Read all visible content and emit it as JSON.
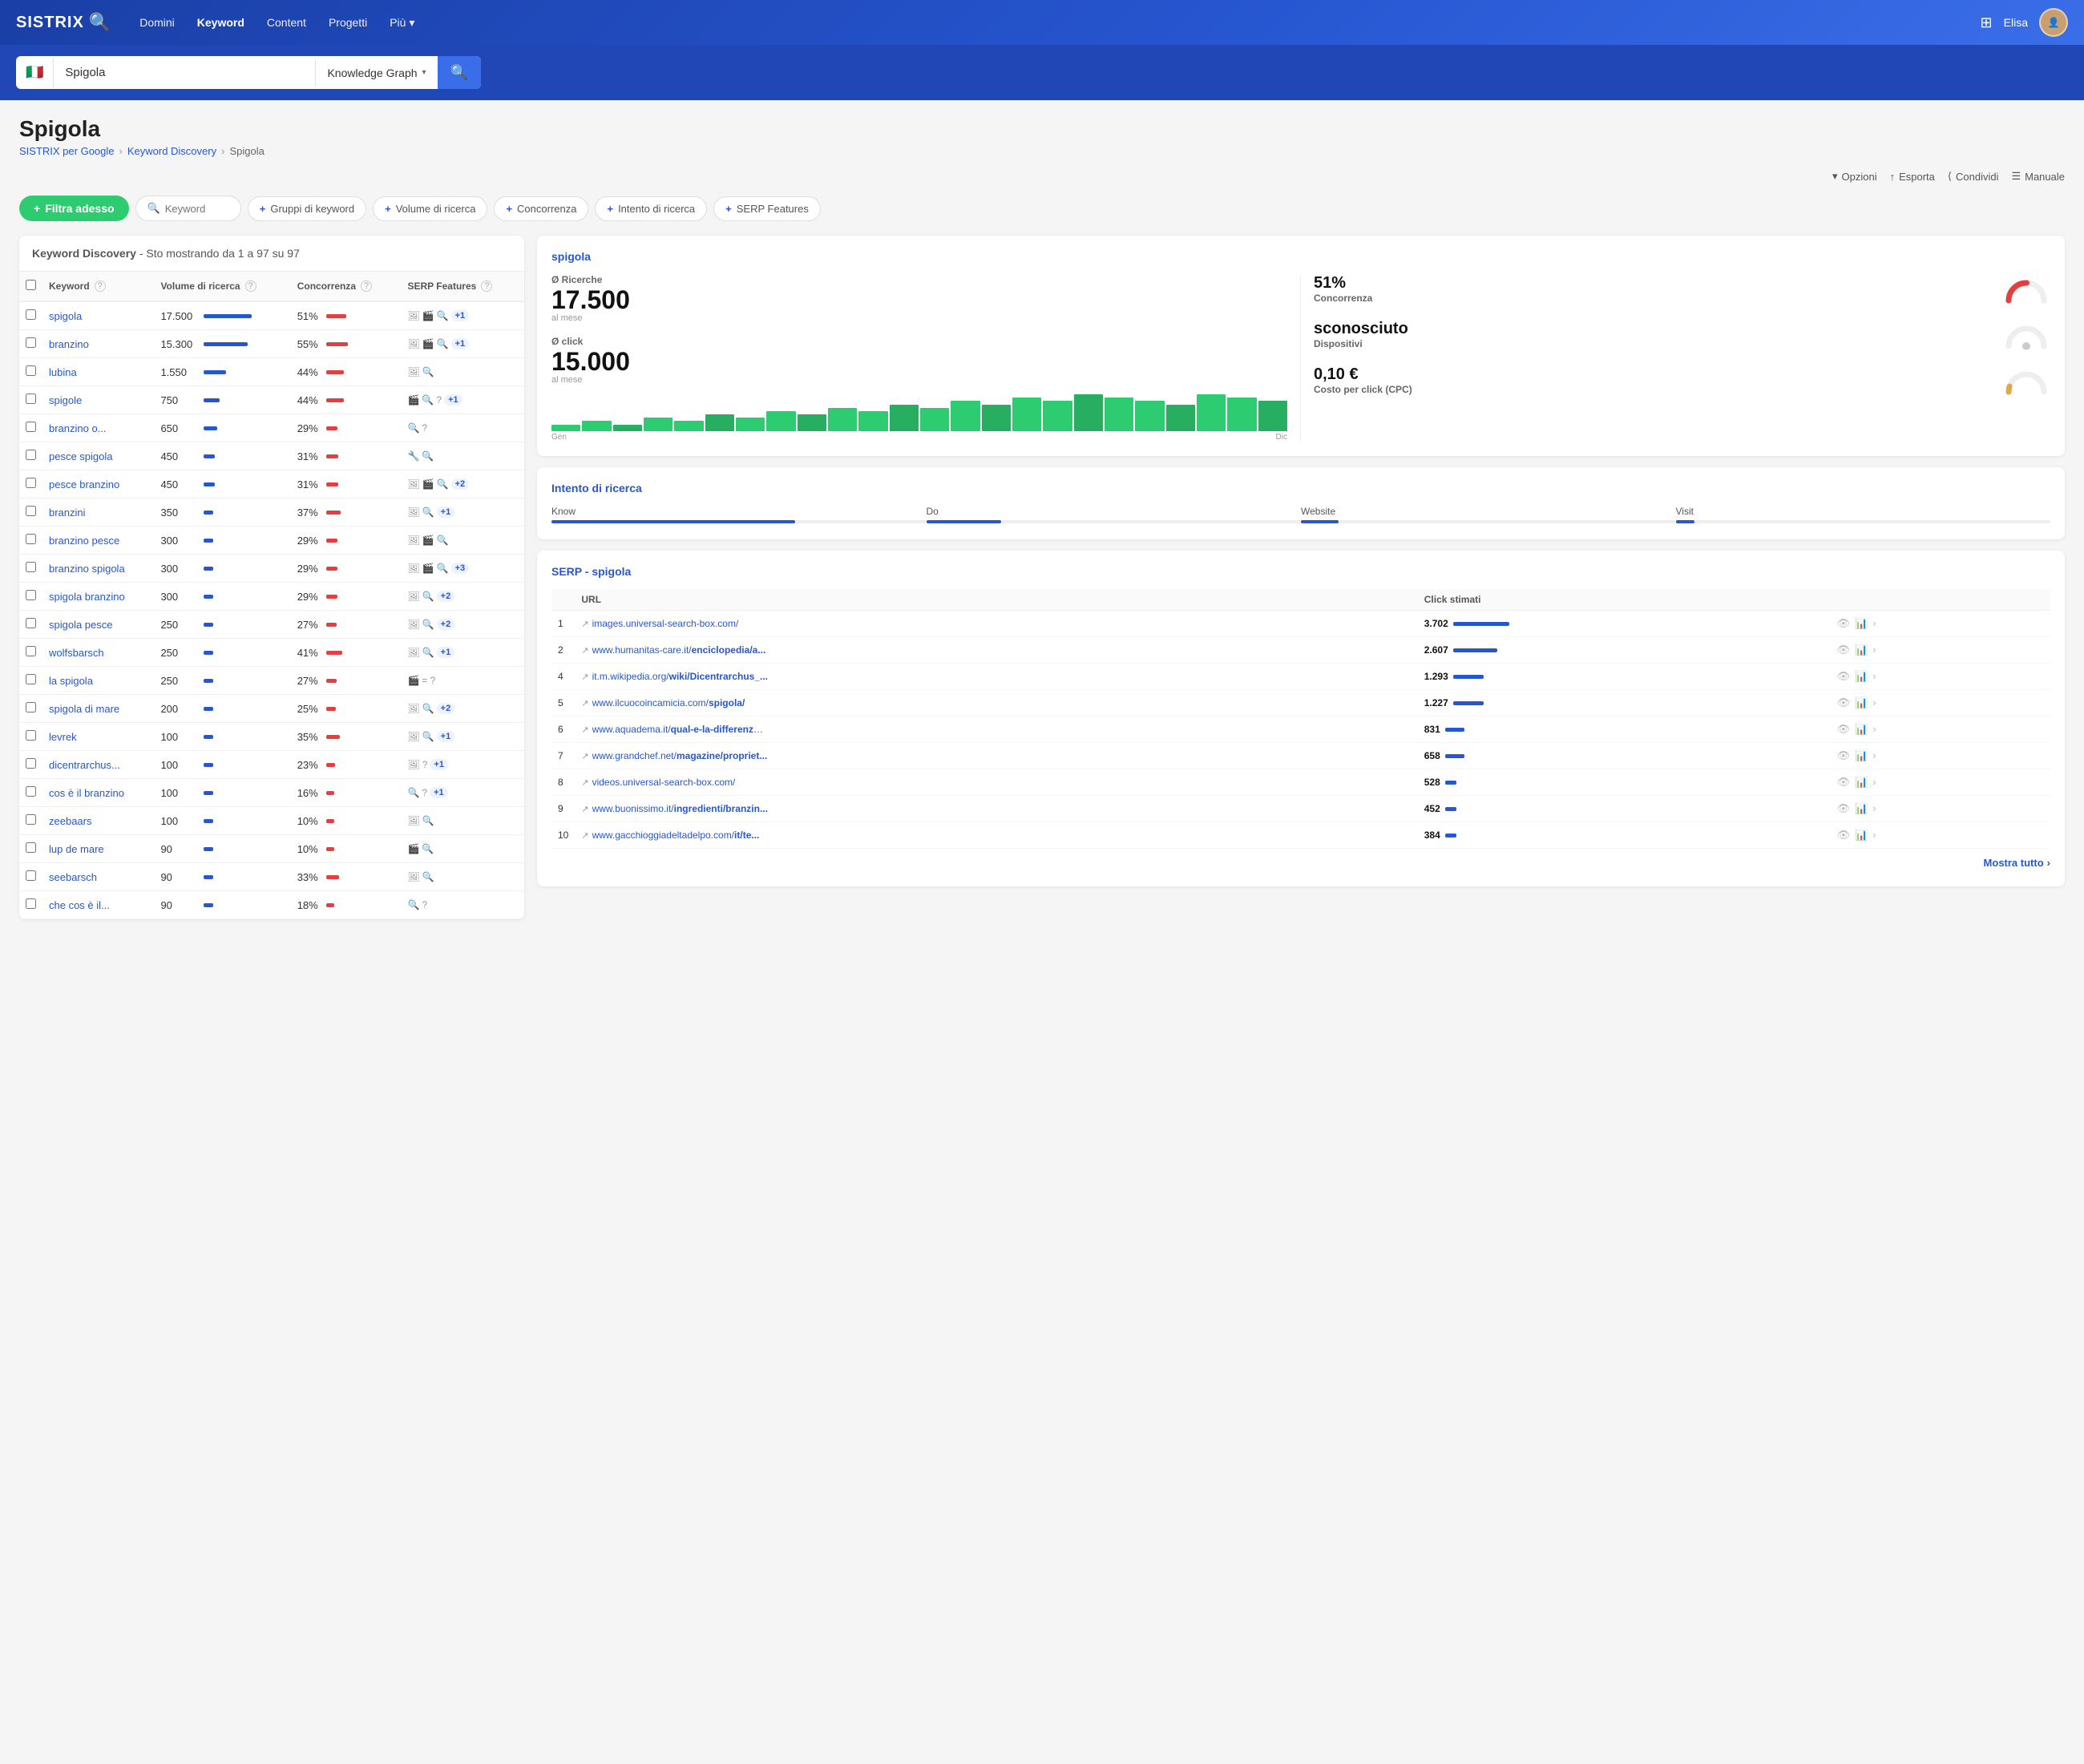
{
  "nav": {
    "logo": "SISTRIX",
    "links": [
      "Domini",
      "Keyword",
      "Content",
      "Progetti",
      "Più"
    ],
    "user": "Elisa"
  },
  "search": {
    "flag": "🇮🇹",
    "query": "Spigola",
    "mode": "Knowledge Graph",
    "placeholder": "Keyword"
  },
  "page": {
    "title": "Spigola",
    "breadcrumb": [
      "SISTRIX per Google",
      "Keyword Discovery",
      "Spigola"
    ],
    "actions": [
      "Opzioni",
      "Esporta",
      "Condividi",
      "Manuale"
    ]
  },
  "filters": {
    "add_label": "Filtra adesso",
    "search_placeholder": "Keyword",
    "pills": [
      "Gruppi di keyword",
      "Volume di ricerca",
      "Concorrenza",
      "Intento di ricerca",
      "SERP Features"
    ]
  },
  "table": {
    "title": "Keyword Discovery",
    "subtitle": " - Sto mostrando da 1 a 97 su 97",
    "headers": [
      "Keyword",
      "Volume di ricerca",
      "Concorrenza",
      "SERP Features"
    ],
    "rows": [
      {
        "kw": "spigola",
        "vol": "17.500",
        "bar_vol": 85,
        "comp": "51%",
        "bar_comp": 51,
        "serp": [
          "img",
          "vid",
          "mag",
          "plus1"
        ]
      },
      {
        "kw": "branzino",
        "vol": "15.300",
        "bar_vol": 78,
        "comp": "55%",
        "bar_comp": 55,
        "serp": [
          "img",
          "vid",
          "mag",
          "plus1"
        ]
      },
      {
        "kw": "lubina",
        "vol": "1.550",
        "bar_vol": 40,
        "comp": "44%",
        "bar_comp": 44,
        "serp": [
          "img",
          "mag"
        ]
      },
      {
        "kw": "spigole",
        "vol": "750",
        "bar_vol": 28,
        "comp": "44%",
        "bar_comp": 44,
        "serp": [
          "vid",
          "mag",
          "qm",
          "plus1"
        ]
      },
      {
        "kw": "branzino o...",
        "vol": "650",
        "bar_vol": 24,
        "comp": "29%",
        "bar_comp": 29,
        "serp": [
          "mag",
          "qm"
        ]
      },
      {
        "kw": "pesce spigola",
        "vol": "450",
        "bar_vol": 20,
        "comp": "31%",
        "bar_comp": 31,
        "serp": [
          "tool",
          "mag"
        ]
      },
      {
        "kw": "pesce branzino",
        "vol": "450",
        "bar_vol": 20,
        "comp": "31%",
        "bar_comp": 31,
        "serp": [
          "img",
          "vid",
          "mag",
          "plus2"
        ]
      },
      {
        "kw": "branzini",
        "vol": "350",
        "bar_vol": 17,
        "comp": "37%",
        "bar_comp": 37,
        "serp": [
          "img",
          "mag",
          "plus1"
        ]
      },
      {
        "kw": "branzino pesce",
        "vol": "300",
        "bar_vol": 15,
        "comp": "29%",
        "bar_comp": 29,
        "serp": [
          "img",
          "vid",
          "mag"
        ]
      },
      {
        "kw": "branzino spigola",
        "vol": "300",
        "bar_vol": 15,
        "comp": "29%",
        "bar_comp": 29,
        "serp": [
          "img",
          "vid",
          "mag",
          "plus3"
        ]
      },
      {
        "kw": "spigola branzino",
        "vol": "300",
        "bar_vol": 15,
        "comp": "29%",
        "bar_comp": 29,
        "serp": [
          "img",
          "mag",
          "plus2"
        ]
      },
      {
        "kw": "spigola pesce",
        "vol": "250",
        "bar_vol": 13,
        "comp": "27%",
        "bar_comp": 27,
        "serp": [
          "img",
          "mag",
          "plus2"
        ]
      },
      {
        "kw": "wolfsbarsch",
        "vol": "250",
        "bar_vol": 13,
        "comp": "41%",
        "bar_comp": 41,
        "serp": [
          "img",
          "mag",
          "plus1"
        ]
      },
      {
        "kw": "la spigola",
        "vol": "250",
        "bar_vol": 13,
        "comp": "27%",
        "bar_comp": 27,
        "serp": [
          "vid",
          "eq",
          "qm"
        ]
      },
      {
        "kw": "spigola di mare",
        "vol": "200",
        "bar_vol": 11,
        "comp": "25%",
        "bar_comp": 25,
        "serp": [
          "img",
          "mag",
          "plus2"
        ]
      },
      {
        "kw": "levrek",
        "vol": "100",
        "bar_vol": 8,
        "comp": "35%",
        "bar_comp": 35,
        "serp": [
          "img",
          "mag",
          "plus1"
        ]
      },
      {
        "kw": "dicentrarchus...",
        "vol": "100",
        "bar_vol": 8,
        "comp": "23%",
        "bar_comp": 23,
        "serp": [
          "img",
          "qm",
          "plus1"
        ]
      },
      {
        "kw": "cos è il branzino",
        "vol": "100",
        "bar_vol": 8,
        "comp": "16%",
        "bar_comp": 16,
        "serp": [
          "mag",
          "qm",
          "plus1"
        ]
      },
      {
        "kw": "zeebaars",
        "vol": "100",
        "bar_vol": 8,
        "comp": "10%",
        "bar_comp": 10,
        "serp": [
          "img",
          "mag"
        ]
      },
      {
        "kw": "lup de mare",
        "vol": "90",
        "bar_vol": 7,
        "comp": "10%",
        "bar_comp": 10,
        "serp": [
          "vid",
          "mag"
        ]
      },
      {
        "kw": "seebarsch",
        "vol": "90",
        "bar_vol": 7,
        "comp": "33%",
        "bar_comp": 33,
        "serp": [
          "img",
          "mag"
        ]
      },
      {
        "kw": "che cos è il...",
        "vol": "90",
        "bar_vol": 7,
        "comp": "18%",
        "bar_comp": 18,
        "serp": [
          "mag",
          "qm"
        ]
      }
    ]
  },
  "right": {
    "keyword_card": {
      "title": "spigola",
      "ricerche_label": "Ø Ricerche",
      "ricerche_sub": "al mese",
      "ricerche_value": "17.500",
      "click_label": "Ø click",
      "click_sub": "al mese",
      "click_value": "15.000",
      "concorrenza_pct": "51%",
      "concorrenza_label": "Concorrenza",
      "dispositivi_value": "sconosciuto",
      "dispositivi_label": "Dispositivi",
      "cpc_value": "0,10 €",
      "cpc_label": "Costo per click (CPC)",
      "chart_bars": [
        2,
        3,
        2,
        4,
        3,
        5,
        4,
        6,
        5,
        7,
        6,
        8,
        7,
        9,
        8,
        10,
        9,
        11,
        10,
        9,
        8,
        11,
        10,
        9
      ],
      "chart_gen": "Gen",
      "chart_dic": "Dic"
    },
    "intent_card": {
      "title": "Intento di ricerca",
      "items": [
        {
          "label": "Know",
          "fill": 65
        },
        {
          "label": "Do",
          "fill": 20
        },
        {
          "label": "Website",
          "fill": 10
        },
        {
          "label": "Visit",
          "fill": 5
        }
      ]
    },
    "serp_card": {
      "title": "SERP - spigola",
      "headers": [
        "",
        "URL",
        "Click stimati",
        ""
      ],
      "rows": [
        {
          "num": "1",
          "url": "images.universal-search-box.com/",
          "url_bold": "",
          "clicks": "3.702",
          "bar_size": "large"
        },
        {
          "num": "2",
          "url": "www.humanitas-care.it/",
          "url_bold": "enciclopedia/a...",
          "clicks": "2.607",
          "bar_size": "medium"
        },
        {
          "num": "4",
          "url": "it.m.wikipedia.org/",
          "url_bold": "wiki/Dicentrarchus_...",
          "clicks": "1.293",
          "bar_size": "small"
        },
        {
          "num": "5",
          "url": "www.ilcuocoincamicia.com/",
          "url_bold": "spigola/",
          "clicks": "1.227",
          "bar_size": "small"
        },
        {
          "num": "6",
          "url": "www.aquadema.it/",
          "url_bold": "qual-e-la-differenza-...",
          "clicks": "831",
          "bar_size": "xsmall"
        },
        {
          "num": "7",
          "url": "www.grandchef.net/",
          "url_bold": "magazine/propriet...",
          "clicks": "658",
          "bar_size": "xsmall"
        },
        {
          "num": "8",
          "url": "videos.universal-search-box.com/",
          "url_bold": "",
          "clicks": "528",
          "bar_size": "xxsmall"
        },
        {
          "num": "9",
          "url": "www.buonissimo.it/",
          "url_bold": "ingredienti/branzin...",
          "clicks": "452",
          "bar_size": "xxsmall"
        },
        {
          "num": "10",
          "url": "www.gacchioggiadeltadelpo.com/",
          "url_bold": "it/te...",
          "clicks": "384",
          "bar_size": "xxsmall"
        }
      ],
      "mostra_tutto": "Mostra tutto"
    }
  }
}
